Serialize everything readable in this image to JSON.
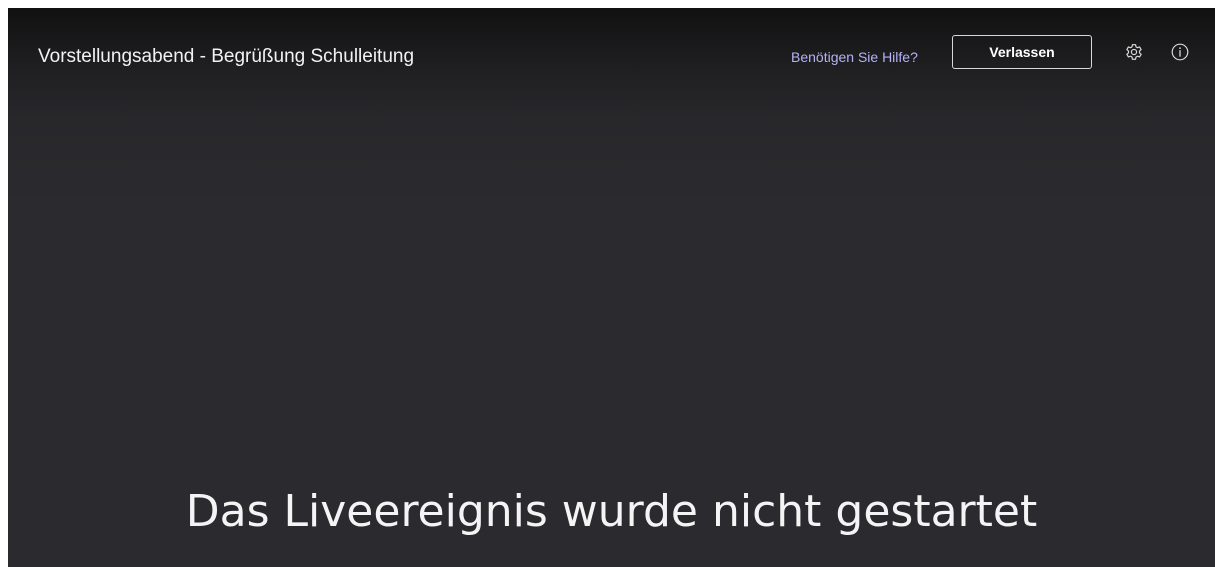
{
  "header": {
    "title": "Vorstellungsabend - Begrüßung Schulleitung",
    "help_link": "Benötigen Sie Hilfe?",
    "leave_button": "Verlassen",
    "icons": {
      "settings": "gear-icon",
      "info": "info-icon"
    }
  },
  "main": {
    "status_message": "Das Liveereignis wurde nicht gestartet"
  },
  "colors": {
    "background": "#2b2b2f",
    "header_background": "#111112",
    "link": "#b4b2f5",
    "text": "#f2f2f2"
  }
}
